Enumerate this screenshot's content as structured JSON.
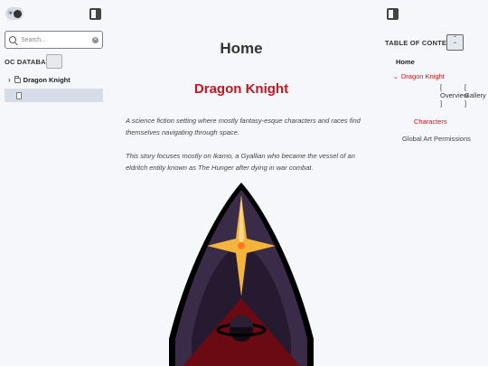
{
  "sidebar": {
    "search": {
      "placeholder": "Search..."
    },
    "database_label": "OC DATABASE",
    "tree": [
      {
        "label": "Dragon Knight"
      }
    ]
  },
  "main": {
    "title": "Home",
    "heading": "Dragon Knight",
    "paragraphs": [
      "A science fiction setting where mostly fantasy-esque characters and races find themselves navigating through space.",
      "This story focuses mostly on Ikamo, a Gyallian who became the vessel of an eldritch entity known as The Hunger after dying in war combat."
    ]
  },
  "toc": {
    "label": "TABLE OF CONTENTS",
    "home": "Home",
    "dragon_knight": "Dragon Knight",
    "overview": "Overview",
    "gallery": "Gallery",
    "characters": "Characters",
    "art_permissions": "Global Art Permissions"
  },
  "icons": {
    "theme": "sun-moon-toggle",
    "panel": "panel-toggle-icon",
    "search": "search-icon",
    "clear": "clear-icon",
    "chevron": "chevron-icon",
    "folder": "folder-icon",
    "file": "file-icon"
  },
  "colors": {
    "accent": "#c8141e",
    "background": "#f5f7fa",
    "emblem_dark": "#251a30",
    "star": "#f4b43c"
  }
}
